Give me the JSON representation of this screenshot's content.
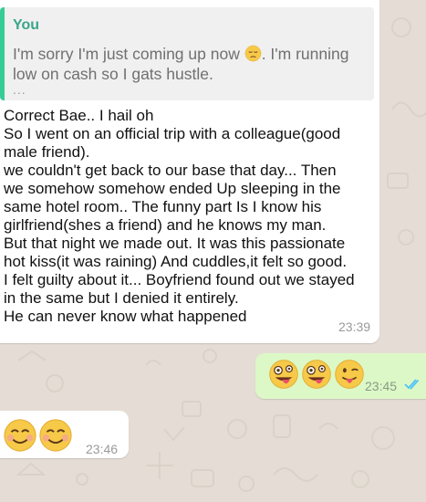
{
  "chat": {
    "messages": [
      {
        "direction": "incoming",
        "quote": {
          "author": "You",
          "text": "I'm sorry I'm just coming up now 😔. I'm running low on cash so I gats hustle.",
          "text_line1_before_emoji": "I'm sorry I'm just coming up now ",
          "text_line1_after_emoji": ". I'm running",
          "text_line2": "low on cash so I gats hustle.",
          "emoji": "pensive-face",
          "more": "..."
        },
        "lines": [
          "Correct Bae.. I hail oh",
          "So I went on an official trip with a colleague(good",
          "male friend).",
          "we couldn't get back to our base that day... Then",
          "we somehow somehow ended Up sleeping in the",
          "same hotel room.. The funny part Is I know his",
          "girlfriend(shes a friend) and he knows my man.",
          "But that night we made out. It was this passionate",
          "hot kiss(it was raining) And cuddles,it felt so good.",
          "I felt guilty about it... Boyfriend found out we stayed",
          "in the same but I denied it entirely.",
          "He can never know what happened"
        ],
        "time": "23:39"
      },
      {
        "direction": "outgoing",
        "emojis": [
          "zany-face",
          "zany-face",
          "winking-tongue-face"
        ],
        "time": "23:45",
        "status": "read",
        "status_icon": "double-check-icon",
        "status_color": "#4fc3f7"
      },
      {
        "direction": "incoming",
        "emojis": [
          "smiling-face",
          "smiling-face"
        ],
        "time": "23:46"
      }
    ]
  },
  "colors": {
    "background": "#e5ddd5",
    "incoming_bubble": "#ffffff",
    "outgoing_bubble": "#dcf8c6",
    "quote_accent": "#35cd96",
    "quote_author": "#3aa58a",
    "read_ticks": "#4fc3f7"
  }
}
